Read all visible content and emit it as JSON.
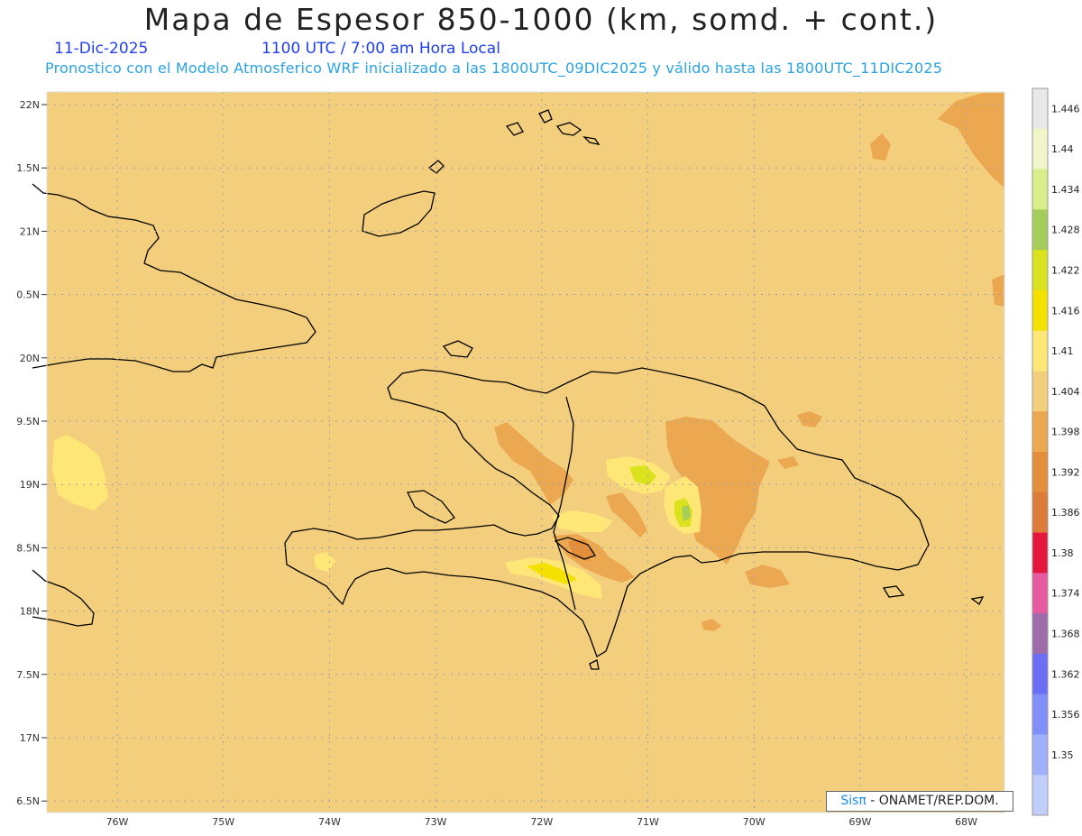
{
  "header": {
    "title": "Mapa de Espesor 850-1000 (km, somd. + cont.)",
    "date": "11-Dic-2025",
    "time": "1100 UTC / 7:00 am Hora Local",
    "model_line": "Pronostico con el Modelo Atmosferico WRF inicializado a las 1800UTC_09DIC2025 y válido hasta las  1800UTC_11DIC2025"
  },
  "map": {
    "lat_labels": [
      "22N",
      "1.5N",
      "21N",
      "0.5N",
      "20N",
      "9.5N",
      "19N",
      "8.5N",
      "18N",
      "7.5N",
      "17N",
      "6.5N"
    ],
    "lon_labels": [
      "76W",
      "75W",
      "74W",
      "73W",
      "72W",
      "71W",
      "70W",
      "69W",
      "68W"
    ],
    "base_fill": "#f3cf7d",
    "coastline_color": "#000000"
  },
  "legend": {
    "labels": [
      "1.446",
      "1.44",
      "1.434",
      "1.428",
      "1.422",
      "1.416",
      "1.41",
      "1.404",
      "1.398",
      "1.392",
      "1.386",
      "1.38",
      "1.374",
      "1.368",
      "1.362",
      "1.356",
      "1.35"
    ],
    "colors": [
      "#e8e8e8",
      "#f1f5c8",
      "#d9ef8b",
      "#a6cd5a",
      "#d9e21c",
      "#f5e100",
      "#ffe777",
      "#f3cf7d",
      "#eca851",
      "#e48d3a",
      "#dd7b38",
      "#e3183c",
      "#e75aa0",
      "#9e6ca8",
      "#6a6ff5",
      "#8090f8",
      "#9fb0fb",
      "#c1cdfb"
    ]
  },
  "credit": {
    "brand": "Sis",
    "pi": "π",
    "text": "- ONAMET/REP.DOM."
  }
}
